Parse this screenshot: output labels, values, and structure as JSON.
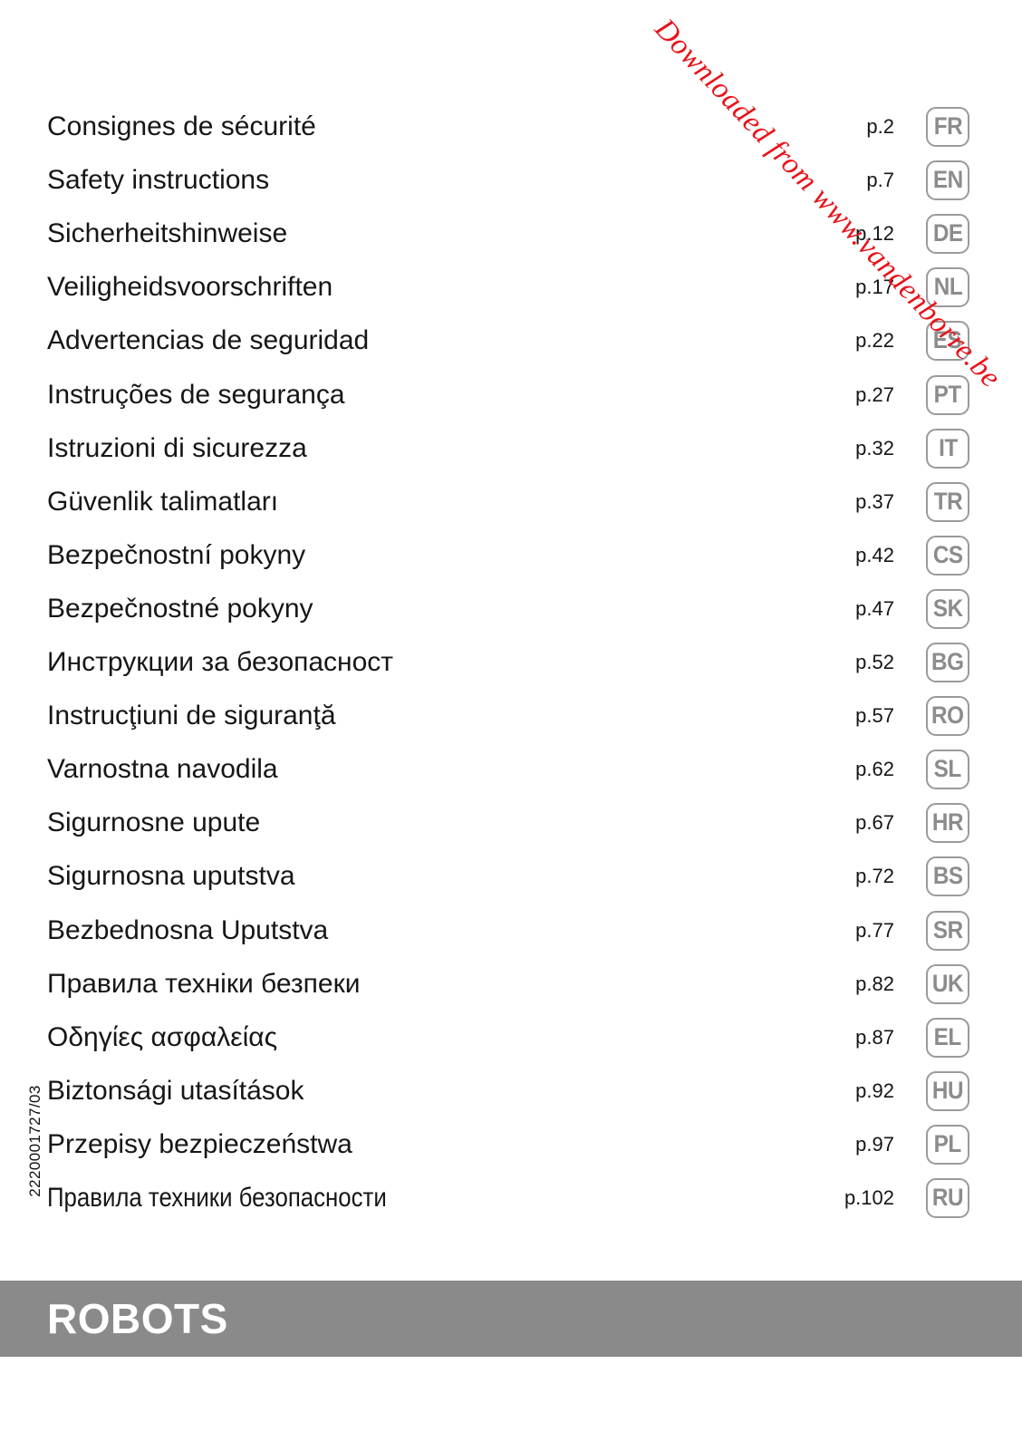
{
  "page": {
    "reference_code": "2220001727/03",
    "watermark": "Downloaded from www.vandenborre.be",
    "watermark_color": "#e8131a",
    "footer_title": "ROBOTS",
    "footer_bar_color": "#8a8a8a",
    "badge_border_color": "#9a9a9a",
    "badge_text_color": "#8c8c8c",
    "text_color": "#161616"
  },
  "languages": [
    {
      "name": "Consignes de sécurité",
      "page": "p.2",
      "code": "FR"
    },
    {
      "name": "Safety instructions",
      "page": "p.7",
      "code": "EN"
    },
    {
      "name": "Sicherheitshinweise",
      "page": "p.12",
      "code": "DE"
    },
    {
      "name": "Veiligheidsvoorschriften",
      "page": "p.17",
      "code": "NL"
    },
    {
      "name": "Advertencias de seguridad",
      "page": "p.22",
      "code": "ES"
    },
    {
      "name": "Instruções de segurança",
      "page": "p.27",
      "code": "PT"
    },
    {
      "name": "Istruzioni di sicurezza",
      "page": "p.32",
      "code": "IT"
    },
    {
      "name": "Güvenlik talimatları",
      "page": "p.37",
      "code": "TR"
    },
    {
      "name": "Bezpečnostní pokyny",
      "page": "p.42",
      "code": "CS"
    },
    {
      "name": "Bezpečnostné pokyny",
      "page": "p.47",
      "code": "SK"
    },
    {
      "name": "Инструкции за безопасност",
      "page": "p.52",
      "code": "BG"
    },
    {
      "name": "Instrucţiuni de siguranţă",
      "page": "p.57",
      "code": "RO"
    },
    {
      "name": "Varnostna navodila",
      "page": "p.62",
      "code": "SL"
    },
    {
      "name": "Sigurnosne upute",
      "page": "p.67",
      "code": "HR"
    },
    {
      "name": "Sigurnosna uputstva",
      "page": "p.72",
      "code": "BS"
    },
    {
      "name": "Bezbednosna Uputstva",
      "page": "p.77",
      "code": "SR"
    },
    {
      "name": "Правила техніки безпеки",
      "page": "p.82",
      "code": "UK"
    },
    {
      "name": "Οδηγίες ασφαλείας",
      "page": "p.87",
      "code": "EL"
    },
    {
      "name": "Biztonsági utasítások",
      "page": "p.92",
      "code": "HU"
    },
    {
      "name": "Przepisy bezpieczeństwa",
      "page": "p.97",
      "code": "PL"
    },
    {
      "name": "Правила техники безопасности",
      "page": "p.102",
      "code": "RU"
    }
  ]
}
